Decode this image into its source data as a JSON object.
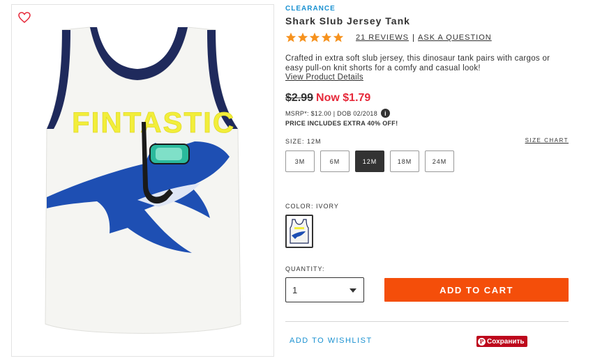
{
  "product": {
    "badge": "CLEARANCE",
    "title": "Shark Slub Jersey Tank",
    "rating_stars": 5,
    "reviews_link": "21 REVIEWS",
    "ask_link": "ASK A QUESTION",
    "description": "Crafted in extra soft slub jersey, this dinosaur tank pairs with cargos or easy pull-on knit shorts for a comfy and casual look!",
    "details_link": "View Product Details",
    "old_price": "$2.99",
    "now_price": "Now $1.79",
    "msrp": "MSRP*: $12.00 | DOB 02/2018",
    "extra_off": "PRICE INCLUDES EXTRA 40% OFF!",
    "shirt_print": "FINTASTIC"
  },
  "size": {
    "label": "SIZE: 12M",
    "chart_link": "SIZE CHART",
    "options": [
      "3M",
      "6M",
      "12M",
      "18M",
      "24M"
    ],
    "selected": "12M"
  },
  "color": {
    "label": "COLOR: IVORY"
  },
  "quantity": {
    "label": "QUANTITY:",
    "value": "1"
  },
  "actions": {
    "add_to_cart": "ADD TO CART",
    "wishlist": "ADD TO WISHLIST",
    "pin_save": "Сохранить"
  },
  "colors": {
    "accent_blue": "#1a91d1",
    "sale_red": "#e6293a",
    "cart_orange": "#f44e0a",
    "star_orange": "#f6921e",
    "pinterest_red": "#bd081c"
  },
  "icons": [
    "heart-icon",
    "star-icon",
    "info-icon",
    "chevron-down-icon",
    "pinterest-icon"
  ]
}
